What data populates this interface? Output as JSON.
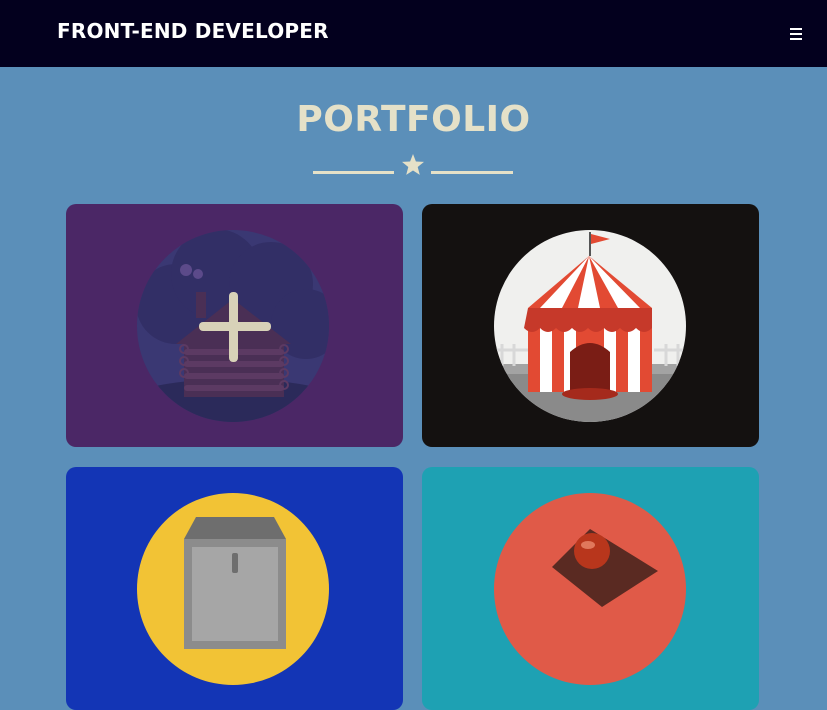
{
  "navbar": {
    "brand": "FRONT-END DEVELOPER",
    "menu_icon": "hamburger-menu-icon"
  },
  "section": {
    "title": "PORTFOLIO",
    "divider_icon": "star-icon"
  },
  "portfolio_items": [
    {
      "illustration": "log-cabin",
      "background": "#4b2766",
      "overlay_icon": "plus-icon"
    },
    {
      "illustration": "circus-tent",
      "background": "#141110"
    },
    {
      "illustration": "safe",
      "background": "#1335b5"
    },
    {
      "illustration": "cake",
      "background": "#1ea1b3"
    }
  ],
  "colors": {
    "navbar_bg": "#03001e",
    "page_bg": "#5b8fb9",
    "title": "#e5e1c8"
  }
}
